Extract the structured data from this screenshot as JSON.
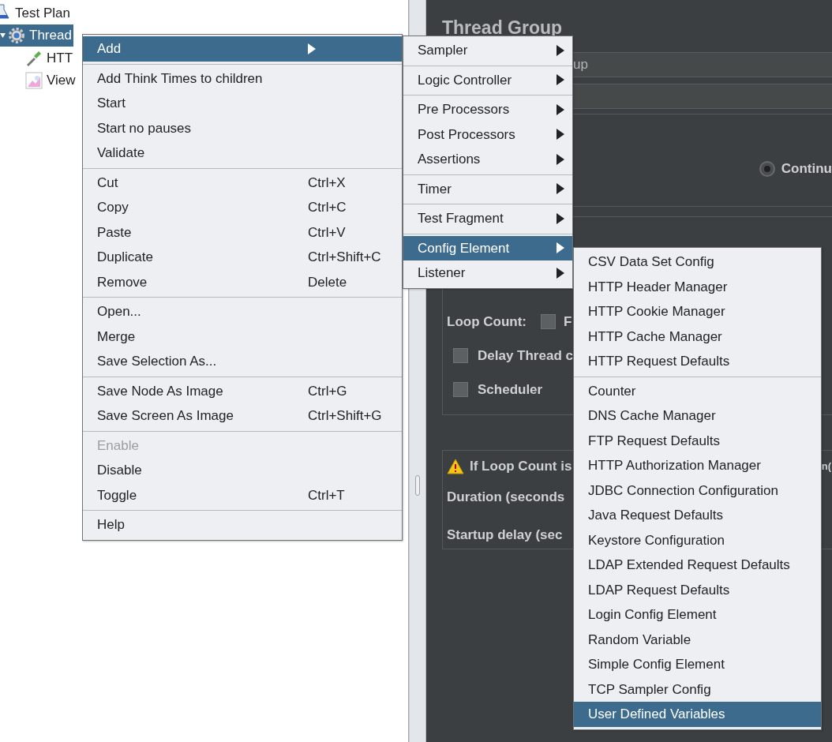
{
  "tree": {
    "items": [
      {
        "label": "Test Plan",
        "kind": "flask",
        "selected": false,
        "children": [
          {
            "label": "Thread",
            "kind": "gear",
            "selected": true,
            "expanded": true,
            "children": [
              {
                "label": "HTT",
                "kind": "dropper",
                "selected": false
              },
              {
                "label": "View",
                "kind": "chart",
                "selected": false
              }
            ]
          }
        ]
      }
    ]
  },
  "editor": {
    "title": "Thread Group",
    "name_value": "up",
    "error_action": {
      "option_label": "Continu",
      "selected": true
    },
    "loop_count": {
      "label": "Loop Count:",
      "checked": false,
      "option_label": "F"
    },
    "delay_thread": {
      "label": "Delay Thread c",
      "checked": false
    },
    "scheduler": {
      "label": "Scheduler",
      "checked": false
    },
    "scheduler_config": {
      "warning": "If Loop Count is",
      "warning_tail": "n(",
      "duration_label": "Duration (seconds",
      "startup_label": "Startup delay (sec"
    }
  },
  "context_menu": {
    "groups": [
      {
        "items": [
          {
            "label": "Add",
            "submenu": true,
            "selected": true,
            "disabled": false
          }
        ]
      },
      {
        "items": [
          {
            "label": "Add Think Times to children",
            "selected": false,
            "disabled": false
          },
          {
            "label": "Start",
            "selected": false,
            "disabled": false
          },
          {
            "label": "Start no pauses",
            "selected": false,
            "disabled": false
          },
          {
            "label": "Validate",
            "selected": false,
            "disabled": false
          }
        ]
      },
      {
        "items": [
          {
            "label": "Cut",
            "shortcut": "Ctrl+X",
            "selected": false,
            "disabled": false
          },
          {
            "label": "Copy",
            "shortcut": "Ctrl+C",
            "selected": false,
            "disabled": false
          },
          {
            "label": "Paste",
            "shortcut": "Ctrl+V",
            "selected": false,
            "disabled": false
          },
          {
            "label": "Duplicate",
            "shortcut": "Ctrl+Shift+C",
            "selected": false,
            "disabled": false
          },
          {
            "label": "Remove",
            "shortcut": "Delete",
            "selected": false,
            "disabled": false
          }
        ]
      },
      {
        "items": [
          {
            "label": "Open...",
            "selected": false,
            "disabled": false
          },
          {
            "label": "Merge",
            "selected": false,
            "disabled": false
          },
          {
            "label": "Save Selection As...",
            "selected": false,
            "disabled": false
          }
        ]
      },
      {
        "items": [
          {
            "label": "Save Node As Image",
            "shortcut": "Ctrl+G",
            "selected": false,
            "disabled": false
          },
          {
            "label": "Save Screen As Image",
            "shortcut": "Ctrl+Shift+G",
            "selected": false,
            "disabled": false
          }
        ]
      },
      {
        "items": [
          {
            "label": "Enable",
            "selected": false,
            "disabled": true
          },
          {
            "label": "Disable",
            "selected": false,
            "disabled": false
          },
          {
            "label": "Toggle",
            "shortcut": "Ctrl+T",
            "selected": false,
            "disabled": false
          }
        ]
      },
      {
        "items": [
          {
            "label": "Help",
            "selected": false,
            "disabled": false
          }
        ]
      }
    ]
  },
  "add_submenu": {
    "groups": [
      {
        "items": [
          {
            "label": "Sampler",
            "submenu": true,
            "selected": false
          }
        ]
      },
      {
        "items": [
          {
            "label": "Logic Controller",
            "submenu": true,
            "selected": false
          }
        ]
      },
      {
        "items": [
          {
            "label": "Pre Processors",
            "submenu": true,
            "selected": false
          },
          {
            "label": "Post Processors",
            "submenu": true,
            "selected": false
          },
          {
            "label": "Assertions",
            "submenu": true,
            "selected": false
          }
        ]
      },
      {
        "items": [
          {
            "label": "Timer",
            "submenu": true,
            "selected": false
          }
        ]
      },
      {
        "items": [
          {
            "label": "Test Fragment",
            "submenu": true,
            "selected": false
          }
        ]
      },
      {
        "items": [
          {
            "label": "Config Element",
            "submenu": true,
            "selected": true
          },
          {
            "label": "Listener",
            "submenu": true,
            "selected": false
          }
        ]
      }
    ]
  },
  "config_submenu": {
    "groups": [
      {
        "items": [
          {
            "label": "CSV Data Set Config",
            "selected": false
          },
          {
            "label": "HTTP Header Manager",
            "selected": false
          },
          {
            "label": "HTTP Cookie Manager",
            "selected": false
          },
          {
            "label": "HTTP Cache Manager",
            "selected": false
          },
          {
            "label": "HTTP Request Defaults",
            "selected": false
          }
        ]
      },
      {
        "items": [
          {
            "label": "Counter",
            "selected": false
          },
          {
            "label": "DNS Cache Manager",
            "selected": false
          },
          {
            "label": "FTP Request Defaults",
            "selected": false
          },
          {
            "label": "HTTP Authorization Manager",
            "selected": false
          },
          {
            "label": "JDBC Connection Configuration",
            "selected": false
          },
          {
            "label": "Java Request Defaults",
            "selected": false
          },
          {
            "label": "Keystore Configuration",
            "selected": false
          },
          {
            "label": "LDAP Extended Request Defaults",
            "selected": false
          },
          {
            "label": "LDAP Request Defaults",
            "selected": false
          },
          {
            "label": "Login Config Element",
            "selected": false
          },
          {
            "label": "Random Variable",
            "selected": false
          },
          {
            "label": "Simple Config Element",
            "selected": false
          },
          {
            "label": "TCP Sampler Config",
            "selected": false
          },
          {
            "label": "User Defined Variables",
            "selected": true
          }
        ]
      }
    ]
  }
}
